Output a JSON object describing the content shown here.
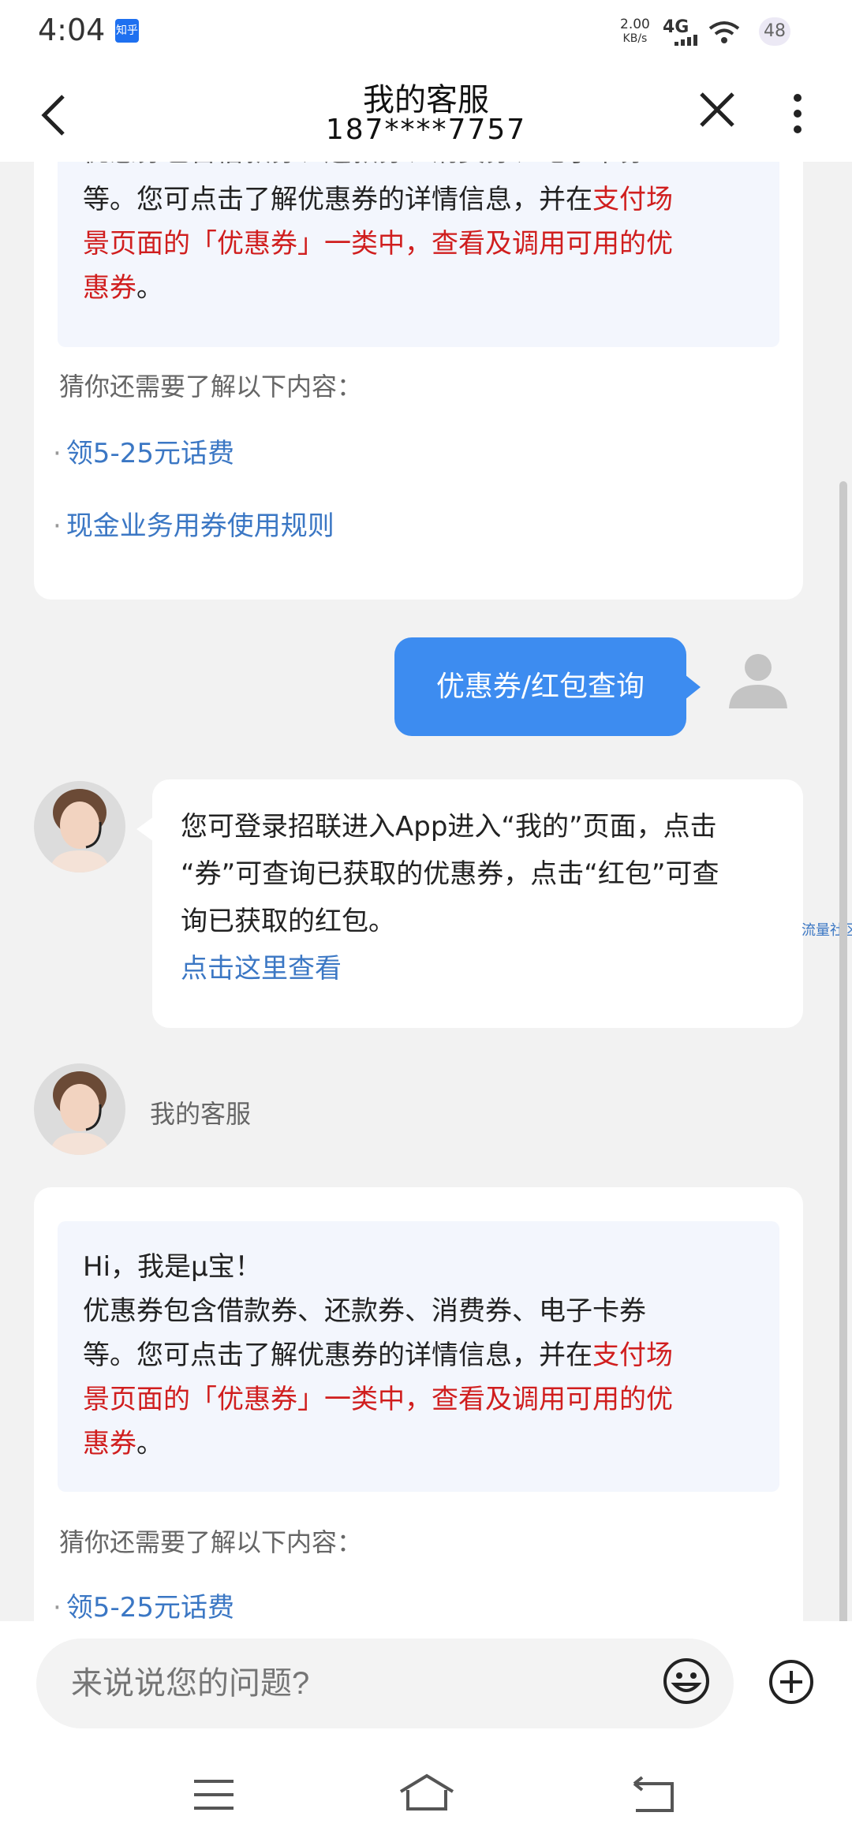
{
  "status_bar": {
    "time": "4:04",
    "app_badge": "知乎",
    "net_rate_value": "2.00",
    "net_rate_unit": "KB/s",
    "network": "4G",
    "battery": "48"
  },
  "header": {
    "title": "我的客服",
    "subtitle": "187****7757"
  },
  "messages": {
    "top_card": {
      "cut_line": "优惠券包含借款券、还款券、消费券、电子卡券",
      "text_line1": "等。您可点击了解优惠券的详情信息，并在",
      "red_line1": "支付场",
      "red_line2": "景页面的「优惠券」一类中，查看及调用可用的优",
      "red_line3": "惠券",
      "end_punct": "。",
      "hint": "猜你还需要了解以下内容：",
      "links": [
        "领5-25元话费",
        "现金业务用券使用规则"
      ]
    },
    "user_message": "优惠券/红包查询",
    "agent_reply": {
      "line1": "您可登录招联进入App进入“我的”页面，点击",
      "line2": "“券”可查询已获取的优惠券，点击“红包”可查",
      "line3": "询已获取的红包。",
      "link": "点击这里查看"
    },
    "side_note": "流量社区",
    "agent_name": "我的客服",
    "bottom_card": {
      "greeting": "Hi，我是μ宝！",
      "line2": "优惠券包含借款券、还款券、消费券、电子卡券",
      "text_line3": "等。您可点击了解优惠券的详情信息，并在",
      "red_line1": "支付场",
      "red_line2": "景页面的「优惠券」一类中，查看及调用可用的优",
      "red_line3": "惠券",
      "end_punct": "。",
      "hint": "猜你还需要了解以下内容：",
      "link1": "领5-25元话费"
    }
  },
  "input": {
    "placeholder": "来说说您的问题?"
  },
  "colors": {
    "accent_blue": "#3d8cf0",
    "link_blue": "#3b77c4",
    "highlight_red": "#d01e1e"
  }
}
